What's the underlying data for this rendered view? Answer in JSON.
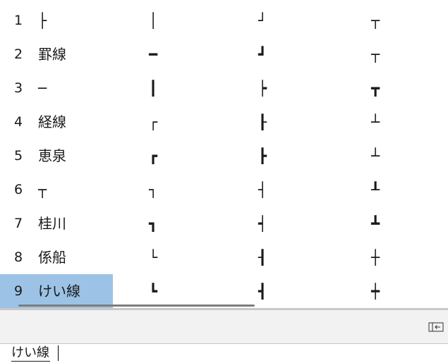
{
  "candidates": [
    [
      "1",
      "├",
      "│",
      "┘",
      "┬"
    ],
    [
      "2",
      "罫線",
      "━",
      "┛",
      "┬"
    ],
    [
      "3",
      "─",
      "┃",
      "┝",
      "┳"
    ],
    [
      "4",
      "経線",
      "┌",
      "┠",
      "┴"
    ],
    [
      "5",
      "恵泉",
      "┏",
      "┣",
      "┴"
    ],
    [
      "6",
      "┬",
      "┐",
      "┤",
      "┸"
    ],
    [
      "7",
      "桂川",
      "┓",
      "┥",
      "┻"
    ],
    [
      "8",
      "係船",
      "└",
      "┨",
      "┼"
    ],
    [
      "9",
      "けい線",
      "┗",
      "┫",
      "┿"
    ]
  ],
  "selected_index": 8,
  "composition_text": "けい線",
  "colors": {
    "selection": "#9cc3e5",
    "footer": "#f2f2f2",
    "accent_top": "#7ac13a"
  },
  "icons": {
    "expand": "expand-table-icon"
  }
}
